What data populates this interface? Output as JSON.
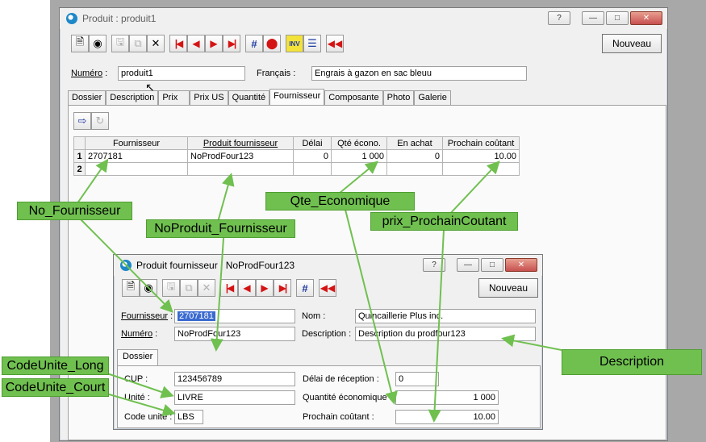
{
  "main_window": {
    "title": "Produit : produit1",
    "help_label": "?",
    "nouveau_label": "Nouveau",
    "numero_label": "Numéro",
    "numero_value": "produit1",
    "francais_label": "Français :",
    "francais_value": "Engrais à gazon en sac bleuu",
    "tabs": [
      "Dossier",
      "Description",
      "Prix",
      "Prix US",
      "Quantité",
      "Fournisseur",
      "Composante",
      "Photo",
      "Galerie"
    ],
    "active_tab": "Fournisseur",
    "grid": {
      "headers": [
        "Fournisseur",
        "Produit fournisseur",
        "Délai",
        "Qté écono.",
        "En achat",
        "Prochain coûtant"
      ],
      "rows": [
        {
          "n": "1",
          "fournisseur": "2707181",
          "produit": "NoProdFour123",
          "delai": "0",
          "qte": "1 000",
          "achat": "0",
          "prochain": "10.00"
        },
        {
          "n": "2",
          "fournisseur": "",
          "produit": "",
          "delai": "",
          "qte": "",
          "achat": "",
          "prochain": ""
        }
      ]
    }
  },
  "sub_window": {
    "title": "Produit fournisseur : NoProdFour123",
    "help_label": "?",
    "nouveau_label": "Nouveau",
    "fournisseur_label": "Fournisseur",
    "fournisseur_value": "2707181",
    "nom_label": "Nom :",
    "nom_value": "Quincaillerie Plus inc.",
    "numero_label": "Numéro",
    "numero_value": "NoProdFour123",
    "description_label": "Description :",
    "description_value": "Description du prodfour123",
    "tab": "Dossier",
    "cup_label": "CUP :",
    "cup_value": "123456789",
    "delai_label": "Délai de réception :",
    "delai_value": "0",
    "unite_label": "Unité :",
    "unite_value": "LIVRE",
    "qte_label": "Quantité économique :",
    "qte_value": "1 000",
    "code_unite_label": "Code unité :",
    "code_unite_value": "LBS",
    "prochain_label": "Prochain coûtant :",
    "prochain_value": "10.00"
  },
  "callouts": {
    "no_fournisseur": "No_Fournisseur",
    "noproduit_fournisseur": "NoProduit_Fournisseur",
    "qte_economique": "Qte_Economique",
    "prix_prochain": "prix_ProchainCoutant",
    "description": "Description",
    "code_unite_long": "CodeUnite_Long",
    "code_unite_court": "CodeUnite_Court"
  },
  "colors": {
    "callout": "#70c050",
    "arrow": "#70c050"
  }
}
